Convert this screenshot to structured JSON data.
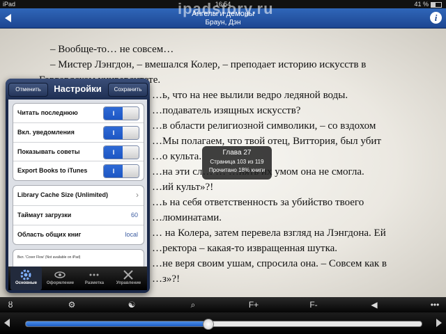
{
  "status_bar": {
    "carrier": "iPad",
    "time": "16:54",
    "battery": "41 %",
    "battery_level": 0.41
  },
  "watermark": "ipadstory.ru",
  "title_bar": {
    "title": "Ангелы и демоны",
    "author": "Браун, Дэн",
    "info_icon": "i"
  },
  "reader_lines": [
    "– Вообще-то… не совсем…",
    "– Мистер Лэнгдон, – вмешался Колер, – преподает историю искусств в",
    "Гарвардском университете.",
    "…ь, что на нее вылили ведро ледяной воды.",
    "…подаватель изящных искусств?",
    "…в области религиозной символики, – со вздохом",
    "…Мы полагаем, что твой отец, Виттория, был убит",
    "…о культа.",
    "…на эти сл… … …нять их умом она не смогла.",
    "…ий культ»?!",
    "…ь на себя ответственность за убийство твоего",
    "…люминатами.",
    "… на Колера, затем перевела взгляд на Лэнгдона. Ей",
    "…ректора – какая-то извращенная шутка.",
    "…не веря своим ушам, спросила она. – Совсем как в",
    "…з»?!"
  ],
  "chapter_overlay": {
    "chapter": "Глава 27",
    "page": "Страница 103 из 119",
    "read": "Прочитано 18% книги"
  },
  "settings": {
    "title": "Настройки",
    "cancel": "Отменить",
    "save": "Сохранить",
    "toggles": [
      {
        "label": "Читать последнюю",
        "state": "I"
      },
      {
        "label": "Вкл. уведомления",
        "state": "I"
      },
      {
        "label": "Показывать советы",
        "state": "I"
      },
      {
        "label": "Export Books to iTunes",
        "state": "I"
      }
    ],
    "options": [
      {
        "label": "Library Cache Size (Unlimited)",
        "value": ""
      },
      {
        "label": "Таймаут загрузки",
        "value": "60"
      },
      {
        "label": "Область общих книг",
        "value": "local"
      }
    ],
    "note": "Вкл. 'Cover Flow' (Not available on iPad)",
    "tabs": [
      {
        "label": "Основные",
        "icon": "gear-icon",
        "active": true
      },
      {
        "label": "Оформление",
        "icon": "eye-icon",
        "active": false
      },
      {
        "label": "Разметка",
        "icon": "dots-icon",
        "active": false
      },
      {
        "label": "Управление",
        "icon": "tools-icon",
        "active": false
      }
    ]
  },
  "toolbar": {
    "tools": [
      "library-icon",
      "settings-gear-icon",
      "day-night-icon",
      "search-icon",
      "font-increase-icon",
      "font-decrease-icon",
      "brightness-icon",
      "more-icon"
    ],
    "glyphs": [
      "ȣ",
      "⚙",
      "☯",
      "⌕",
      "F+",
      "F-",
      "◀",
      "•••"
    ]
  },
  "progress": {
    "fraction": 0.46
  }
}
